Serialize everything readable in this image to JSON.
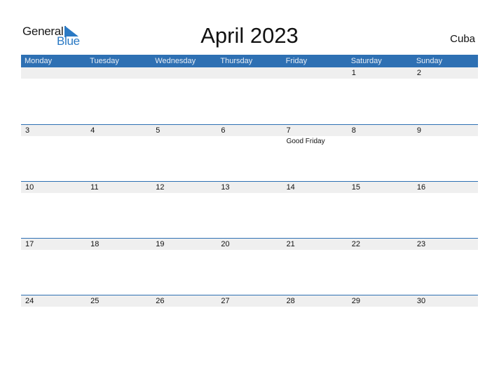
{
  "logo": {
    "general": "General",
    "blue": "Blue"
  },
  "title": "April 2023",
  "country": "Cuba",
  "weekdays": [
    "Monday",
    "Tuesday",
    "Wednesday",
    "Thursday",
    "Friday",
    "Saturday",
    "Sunday"
  ],
  "weeks": [
    {
      "days": [
        "",
        "",
        "",
        "",
        "",
        "1",
        "2"
      ],
      "events": [
        "",
        "",
        "",
        "",
        "",
        "",
        ""
      ]
    },
    {
      "days": [
        "3",
        "4",
        "5",
        "6",
        "7",
        "8",
        "9"
      ],
      "events": [
        "",
        "",
        "",
        "",
        "Good Friday",
        "",
        ""
      ]
    },
    {
      "days": [
        "10",
        "11",
        "12",
        "13",
        "14",
        "15",
        "16"
      ],
      "events": [
        "",
        "",
        "",
        "",
        "",
        "",
        ""
      ]
    },
    {
      "days": [
        "17",
        "18",
        "19",
        "20",
        "21",
        "22",
        "23"
      ],
      "events": [
        "",
        "",
        "",
        "",
        "",
        "",
        ""
      ]
    },
    {
      "days": [
        "24",
        "25",
        "26",
        "27",
        "28",
        "29",
        "30"
      ],
      "events": [
        "",
        "",
        "",
        "",
        "",
        "",
        ""
      ]
    }
  ],
  "colors": {
    "accent": "#2e70b3",
    "logo_blue": "#2a79c4",
    "strip": "#efefef"
  }
}
